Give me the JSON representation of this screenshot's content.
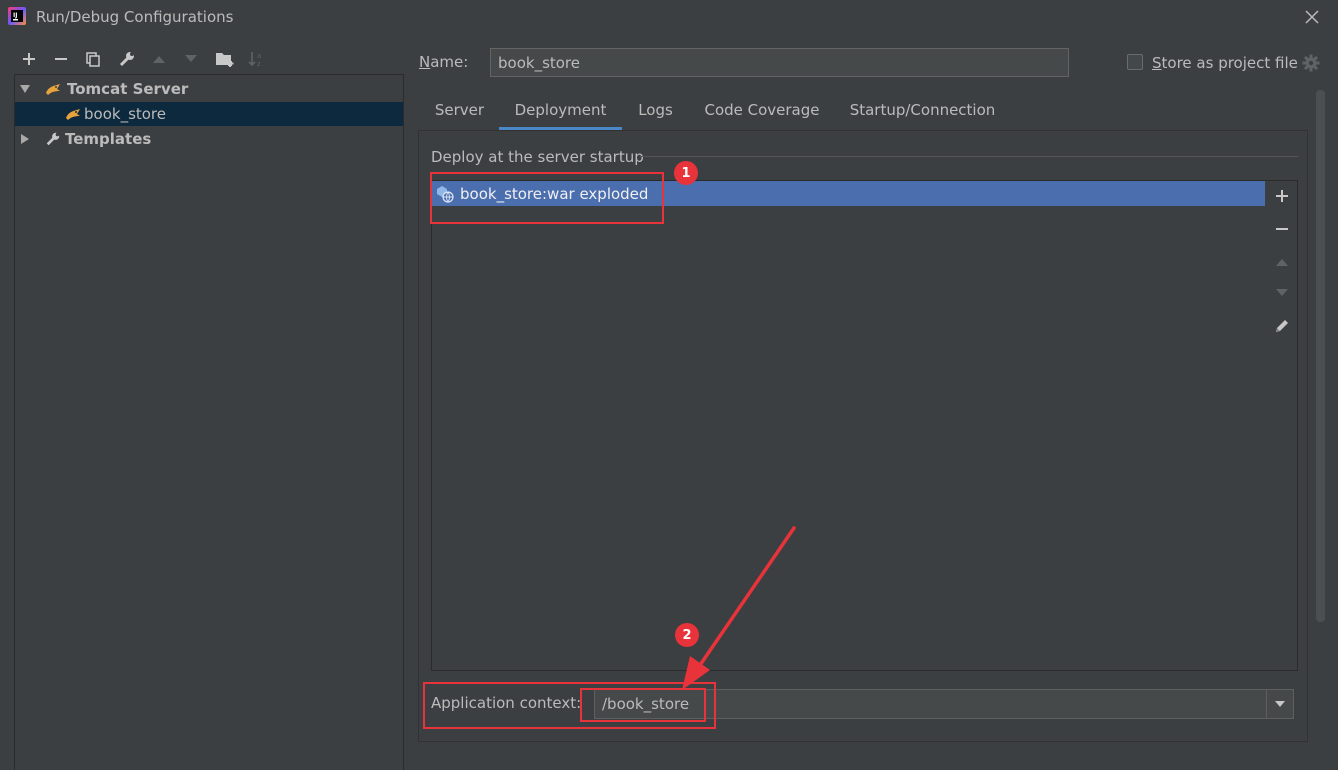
{
  "window": {
    "title": "Run/Debug Configurations"
  },
  "toolbar": {
    "buttons": [
      "add-icon",
      "remove-icon",
      "copy-icon",
      "wrench-icon",
      "move-up-icon",
      "move-down-icon",
      "folder-add-icon",
      "sort-az-icon"
    ]
  },
  "tree": {
    "group": "Tomcat Server",
    "child": "book_store",
    "templates": "Templates"
  },
  "form": {
    "name_label": "Name:",
    "name_value": "book_store",
    "store_label": "Store as project file",
    "store_checked": false
  },
  "tabs": [
    "Server",
    "Deployment",
    "Logs",
    "Code Coverage",
    "Startup/Connection"
  ],
  "active_tab": "Deployment",
  "deployment": {
    "section_title": "Deploy at the server startup",
    "items": [
      "book_store:war exploded"
    ],
    "app_context_label": "Application context:",
    "app_context_value": "/book_store"
  },
  "annotations": {
    "badge_1": "1",
    "badge_2": "2",
    "color": "#e8333a"
  },
  "colors": {
    "background": "#3c3f41",
    "selection": "#4b6eaf",
    "tree_selection": "#0d293e",
    "tab_underline": "#4a88c7"
  }
}
